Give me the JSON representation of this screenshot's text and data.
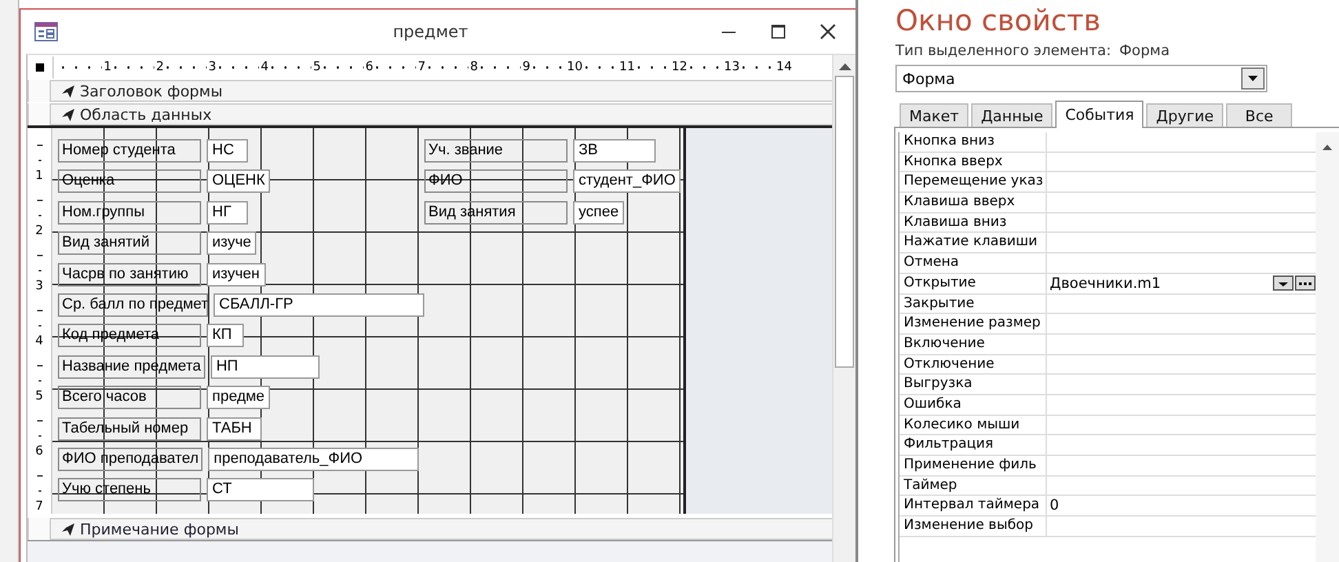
{
  "window": {
    "title": "предмет"
  },
  "ruler": [
    "1",
    "2",
    "3",
    "4",
    "5",
    "6",
    "7",
    "8",
    "9",
    "10",
    "11",
    "12",
    "13",
    "14"
  ],
  "vertical_ruler": [
    "1",
    "2",
    "3",
    "4",
    "5",
    "6",
    "7"
  ],
  "sections": {
    "header": "Заголовок формы",
    "detail": "Область данных",
    "footer": "Примечание формы"
  },
  "controls_left": [
    {
      "label": "Номер студента",
      "value": "НС"
    },
    {
      "label": "Оценка",
      "value": "ОЦЕНК"
    },
    {
      "label": "Ном.группы",
      "value": "НГ"
    },
    {
      "label": "Вид занятий",
      "value": "изуче"
    },
    {
      "label": "Часрв по занятию",
      "value": "изучен"
    },
    {
      "label": "Ср. балл по предмет",
      "value": "СБАЛЛ-ГР"
    },
    {
      "label": "Код предмета",
      "value": "КП"
    },
    {
      "label": "Название предмета",
      "value": "НП"
    },
    {
      "label": "Всего часов",
      "value": "предме"
    },
    {
      "label": "Табельный номер",
      "value": "ТАБН"
    },
    {
      "label": "ФИО преподавател",
      "value": "преподаватель_ФИО"
    },
    {
      "label": "Учю степень",
      "value": "СТ"
    }
  ],
  "controls_right": [
    {
      "label": "Уч. звание",
      "value": "ЗВ"
    },
    {
      "label": "ФИО",
      "value": "студент_ФИО"
    },
    {
      "label": "Вид занятия",
      "value": "успее"
    }
  ],
  "properties": {
    "title": "Окно свойств",
    "selection_label": "Тип выделенного элемента:",
    "selection_type": "Форма",
    "object": "Форма",
    "tabs": [
      {
        "label": "Макет",
        "selected": false
      },
      {
        "label": "Данные",
        "selected": false
      },
      {
        "label": "События",
        "selected": true
      },
      {
        "label": "Другие",
        "selected": false
      },
      {
        "label": "Все",
        "selected": false
      }
    ],
    "rows": [
      {
        "name": "Кнопка вниз",
        "value": "",
        "selected": false
      },
      {
        "name": "Кнопка вверх",
        "value": "",
        "selected": false
      },
      {
        "name": "Перемещение указ",
        "value": "",
        "selected": false
      },
      {
        "name": "Клавиша вверх",
        "value": "",
        "selected": false
      },
      {
        "name": "Клавиша вниз",
        "value": "",
        "selected": false
      },
      {
        "name": "Нажатие клавиши",
        "value": "",
        "selected": false
      },
      {
        "name": "Отмена",
        "value": "",
        "selected": false
      },
      {
        "name": "Открытие",
        "value": "Двоечники.m1",
        "selected": true
      },
      {
        "name": "Закрытие",
        "value": "",
        "selected": false
      },
      {
        "name": "Изменение размер",
        "value": "",
        "selected": false
      },
      {
        "name": "Включение",
        "value": "",
        "selected": false
      },
      {
        "name": "Отключение",
        "value": "",
        "selected": false
      },
      {
        "name": "Выгрузка",
        "value": "",
        "selected": false
      },
      {
        "name": "Ошибка",
        "value": "",
        "selected": false
      },
      {
        "name": "Колесико мыши",
        "value": "",
        "selected": false
      },
      {
        "name": "Фильтрация",
        "value": "",
        "selected": false
      },
      {
        "name": "Применение филь",
        "value": "",
        "selected": false
      },
      {
        "name": "Таймер",
        "value": "",
        "selected": false
      },
      {
        "name": "Интервал таймера",
        "value": "0",
        "selected": false
      },
      {
        "name": "Изменение выбор",
        "value": "",
        "selected": false
      }
    ]
  }
}
